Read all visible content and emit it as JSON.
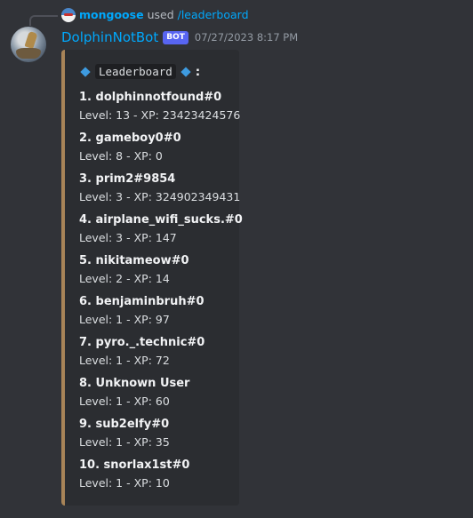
{
  "reply": {
    "username": "mongoose",
    "used_text": "used",
    "command": "/leaderboard"
  },
  "message": {
    "author": "DolphinNotBot",
    "badge": "BOT",
    "timestamp": "07/27/2023 8:17 PM"
  },
  "embed": {
    "accent_color": "#a88458",
    "title_code": "Leaderboard",
    "title_suffix": ":",
    "entries": [
      {
        "name": "1. dolphinnotfound#0",
        "stats": "Level: 13 - XP: 23423424576"
      },
      {
        "name": "2. gameboy0#0",
        "stats": "Level: 8 - XP: 0"
      },
      {
        "name": "3. prim2#9854",
        "stats": "Level: 3 - XP: 324902349431"
      },
      {
        "name": "4. airplane_wifi_sucks.#0",
        "stats": "Level: 3 - XP: 147"
      },
      {
        "name": "5. nikitameow#0",
        "stats": "Level: 2 - XP: 14"
      },
      {
        "name": "6. benjaminbruh#0",
        "stats": "Level: 1 - XP: 97"
      },
      {
        "name": "7. pyro._.technic#0",
        "stats": "Level: 1 - XP: 72"
      },
      {
        "name": "8. Unknown User",
        "stats": "Level: 1 - XP: 60"
      },
      {
        "name": "9. sub2elfy#0",
        "stats": "Level: 1 - XP: 35"
      },
      {
        "name": "10. snorlax1st#0",
        "stats": "Level: 1 - XP: 10"
      }
    ]
  },
  "icons": {
    "reply_avatar": "mongoose-avatar-icon",
    "author_avatar": "dolphinnotbot-avatar-icon",
    "title_decoration": "blue-diamond-icon"
  }
}
